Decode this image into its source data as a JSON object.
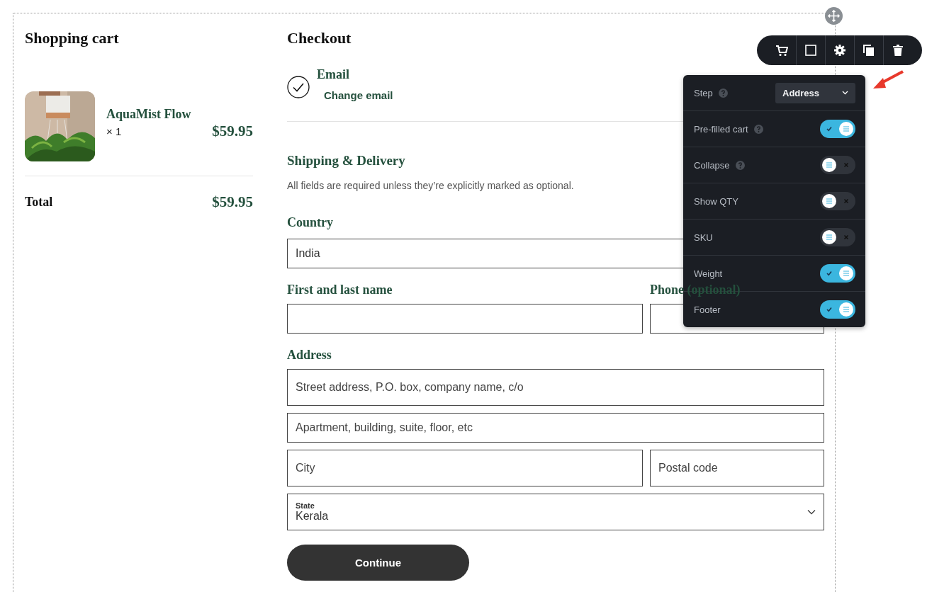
{
  "cart": {
    "title": "Shopping cart",
    "items": [
      {
        "name": "AquaMist Flow",
        "quantity": "× 1",
        "price": "$59.95"
      }
    ],
    "total_label": "Total",
    "total": "$59.95"
  },
  "checkout": {
    "title": "Checkout",
    "email": {
      "label": "Email",
      "completed": true,
      "link": "Change email"
    },
    "shipping_title": "Shipping & Delivery",
    "note": "All fields are required unless they’re explicitly marked as optional.",
    "form": [
      {
        "kind": "label",
        "text": "Country"
      },
      {
        "kind": "row",
        "fields": [
          {
            "kind": "select",
            "value": "India"
          }
        ]
      },
      {
        "kind": "row",
        "fields": [
          {
            "kind": "text",
            "label": "First and last name"
          },
          {
            "kind": "text",
            "label": "Phone (optional)"
          }
        ]
      },
      {
        "kind": "label",
        "text": "Address"
      },
      {
        "kind": "row",
        "fields": [
          {
            "kind": "tall-text",
            "placeholder": "Street address, P.O. box, company name, c/o"
          }
        ]
      },
      {
        "kind": "row",
        "fields": [
          {
            "kind": "text",
            "placeholder": "Apartment, building, suite, floor, etc"
          }
        ]
      },
      {
        "kind": "row",
        "fields": [
          {
            "kind": "tall-text",
            "placeholder": "City"
          },
          {
            "kind": "tall-text",
            "placeholder": "Postal code"
          }
        ]
      },
      {
        "kind": "row",
        "fields": [
          {
            "kind": "tall-select",
            "floating_label": "State",
            "value": "Kerala"
          }
        ]
      }
    ],
    "button": "Continue"
  },
  "toolbar": {
    "buttons": [
      {
        "kind": "cart"
      },
      {
        "kind": "square"
      },
      {
        "kind": "settings"
      },
      {
        "kind": "copy"
      },
      {
        "kind": "delete"
      }
    ]
  },
  "settings_panel": {
    "step": {
      "label": "Step",
      "help": true,
      "value": "Address"
    },
    "toggles": [
      {
        "label": "Pre-filled cart",
        "help": true,
        "on": true
      },
      {
        "label": "Collapse",
        "help": true,
        "on": false
      },
      {
        "label": "Show QTY",
        "help": false,
        "on": false
      },
      {
        "label": "SKU",
        "help": false,
        "on": false
      },
      {
        "label": "Weight",
        "help": false,
        "on": true
      },
      {
        "label": "Footer",
        "help": false,
        "on": true
      }
    ]
  }
}
